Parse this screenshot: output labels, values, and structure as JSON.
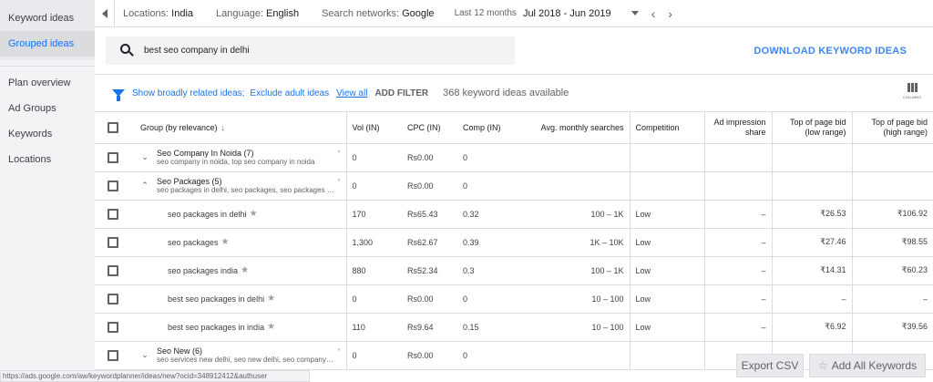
{
  "sidebar": {
    "items": [
      {
        "label": "Keyword ideas"
      },
      {
        "label": "Grouped ideas",
        "active": true
      },
      {
        "label": "Plan overview"
      },
      {
        "label": "Ad Groups"
      },
      {
        "label": "Keywords"
      },
      {
        "label": "Locations"
      }
    ]
  },
  "locbar": {
    "locations_label": "Locations:",
    "locations_value": "India",
    "language_label": "Language:",
    "language_value": "English",
    "networks_label": "Search networks:",
    "networks_value": "Google",
    "period_label": "Last 12 months",
    "period_value": "Jul 2018 - Jun 2019",
    "prev": "‹",
    "next": "›"
  },
  "search": {
    "value": "best seo company in delhi"
  },
  "download_label": "DOWNLOAD KEYWORD IDEAS",
  "filters": {
    "broad": "Show broadly related ideas;",
    "adult": "Exclude adult ideas",
    "view_all": "View all",
    "add_filter": "ADD FILTER",
    "count": "368 keyword ideas available",
    "columns_label": "COLUMNS"
  },
  "table": {
    "headers": {
      "group": "Group (by relevance)",
      "sort_arrow": "↓",
      "vol": "Vol (IN)",
      "cpc": "CPC (IN)",
      "comp": "Comp (IN)",
      "avg": "Avg. monthly searches",
      "competition": "Competition",
      "impression": "Ad impression share",
      "bid_low": "Top of page bid (low range)",
      "bid_high": "Top of page bid (high range)"
    },
    "rows": [
      {
        "type": "group",
        "expand": "⌄",
        "title": "Seo Company In Noida (7)",
        "sub": "seo company in noida, top seo company in noida",
        "vol": "0",
        "cpc": "Rs0.00",
        "comp": "0"
      },
      {
        "type": "group",
        "expand": "⌃",
        "title": "Seo Packages (5)",
        "sub": "seo packages in delhi, seo packages, seo packages india",
        "vol": "0",
        "cpc": "Rs0.00",
        "comp": "0"
      },
      {
        "type": "kw",
        "keyword": "seo packages in delhi",
        "vol": "170",
        "cpc": "Rs65.43",
        "comp": "0.32",
        "avg": "100 – 1K",
        "competition": "Low",
        "impression": "–",
        "low": "₹26.53",
        "high": "₹106.92"
      },
      {
        "type": "kw",
        "keyword": "seo packages",
        "vol": "1,300",
        "cpc": "Rs62.67",
        "comp": "0.39",
        "avg": "1K – 10K",
        "competition": "Low",
        "impression": "–",
        "low": "₹27.46",
        "high": "₹98.55"
      },
      {
        "type": "kw",
        "keyword": "seo packages india",
        "vol": "880",
        "cpc": "Rs52.34",
        "comp": "0.3",
        "avg": "100 – 1K",
        "competition": "Low",
        "impression": "–",
        "low": "₹14.31",
        "high": "₹60.23"
      },
      {
        "type": "kw",
        "keyword": "best seo packages in delhi",
        "vol": "0",
        "cpc": "Rs0.00",
        "comp": "0",
        "avg": "10 – 100",
        "competition": "Low",
        "impression": "–",
        "low": "–",
        "high": "–"
      },
      {
        "type": "kw",
        "keyword": "best seo packages in india",
        "vol": "110",
        "cpc": "Rs9.64",
        "comp": "0.15",
        "avg": "10 – 100",
        "competition": "Low",
        "impression": "–",
        "low": "₹6.92",
        "high": "₹39.56"
      },
      {
        "type": "group",
        "expand": "⌄",
        "title": "Seo New (6)",
        "sub": "seo services new delhi, seo new delhi, seo company new delhi",
        "vol": "0",
        "cpc": "Rs0.00",
        "comp": "0"
      }
    ]
  },
  "status_url": "https://ads.google.com/aw/keywordplanner/ideas/new?ocid=348912412&authuser",
  "export_csv": "Export CSV",
  "add_all": "Add All Keywords"
}
